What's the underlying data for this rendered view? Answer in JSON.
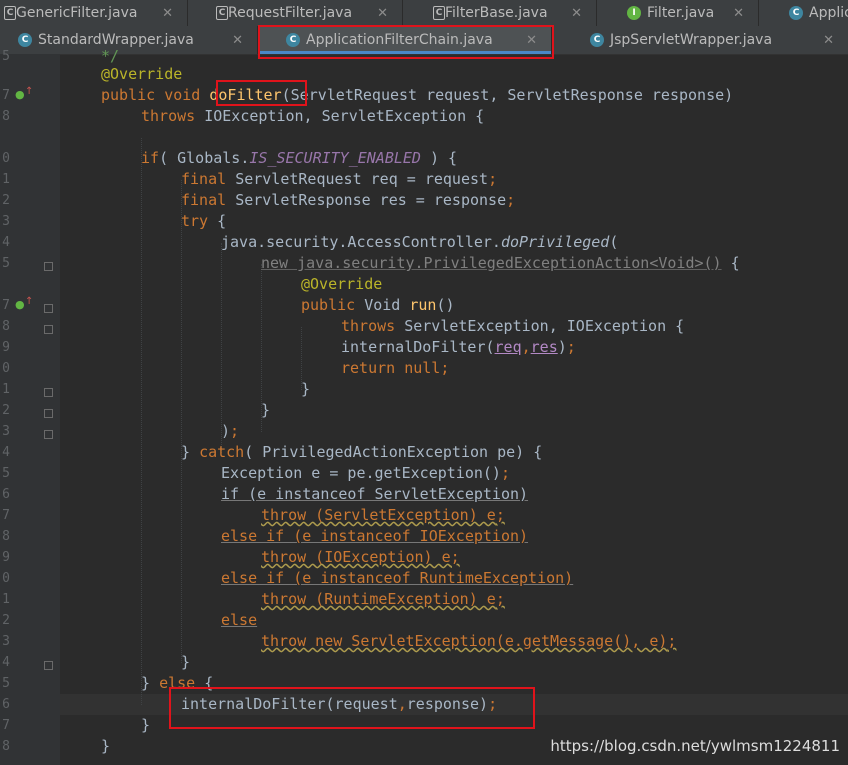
{
  "tabs_row1": [
    {
      "label": "GenericFilter.java"
    },
    {
      "label": "RequestFilter.java"
    },
    {
      "label": "FilterBase.java"
    },
    {
      "label": "Filter.java"
    },
    {
      "label": "Applic"
    }
  ],
  "tabs_row2": [
    {
      "label": "StandardWrapper.java"
    },
    {
      "label": "ApplicationFilterChain.java"
    },
    {
      "label": "JspServletWrapper.java"
    }
  ],
  "close_glyph": "✕",
  "line_numbers": [
    "5",
    "7",
    "8",
    "",
    "0",
    "1",
    "2",
    "3",
    "4",
    "5",
    "",
    "7",
    "8",
    "9",
    "0",
    "1",
    "2",
    "3",
    "4",
    "5",
    "6",
    "7",
    "8",
    "9",
    "0",
    "1",
    "2",
    "3",
    "4",
    "5",
    "6",
    "7",
    "8"
  ],
  "code": {
    "l0": "*/",
    "l1_ann": "@Override",
    "l2_kw": "public void ",
    "l2_fn": "doFilter",
    "l2_rest": "(ServletRequest request, ServletResponse response)",
    "l3_kw": "throws ",
    "l3_rest": "IOException, ServletException {",
    "l5_kw": "if",
    "l5_a": "( Globals.",
    "l5_st": "IS_SECURITY_ENABLED",
    "l5_b": " ) {",
    "l6_kw": "final ",
    "l6_rest": "ServletRequest req = request",
    "l7_kw": "final ",
    "l7_rest": "ServletResponse res = response",
    "semi": ";",
    "l8_kw": "try ",
    "l8_rest": "{",
    "l9_a": "java.security.AccessController.",
    "l9_it": "doPrivileged",
    "l9_b": "(",
    "l10_grey": "new java.security.PrivilegedExceptionAction<Void>()",
    "l10_b": " {",
    "l11_ann": "@Override",
    "l12_kw": "public ",
    "l12_a": "Void ",
    "l12_fn": "run",
    "l12_b": "()",
    "l13_kw": "throws ",
    "l13_rest": "ServletException, IOException {",
    "l14_a": "internalDoFilter(",
    "l14_p1": "req",
    "l14_comma": ",",
    "l14_p2": "res",
    "l14_b": ")",
    "l15_kw": "return null",
    "l16": "}",
    "l17": "}",
    "l18": ")",
    "l19_a": "} ",
    "l19_kw": "catch",
    "l19_b": "( PrivilegedActionException pe) {",
    "l20": "Exception e = pe.getException()",
    "l21": "if (e instanceof ServletException)",
    "l22": "throw (ServletException) e",
    "l23": "else if (e instanceof IOException)",
    "l24": "throw (IOException) e",
    "l25": "else if (e instanceof RuntimeException)",
    "l26": "throw (RuntimeException) e",
    "l27": "else",
    "l28": "throw new ServletException(e.getMessage(), e)",
    "l29": "}",
    "l30_a": "} ",
    "l30_kw": "else",
    "l30_b": " {",
    "l31_a": "internalDoFilter(request",
    "l31_comma": ",",
    "l31_b": "response)",
    "l32": "}",
    "l33": "}"
  },
  "watermark": "https://blog.csdn.net/ywlmsm1224811"
}
